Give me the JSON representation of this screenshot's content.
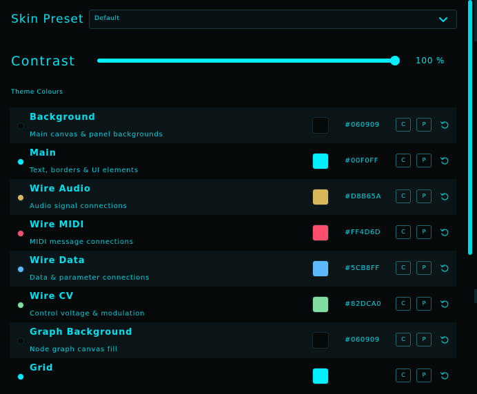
{
  "preset": {
    "label": "Skin Preset",
    "value": "Default"
  },
  "contrast": {
    "label": "Contrast",
    "value_text": "100 %",
    "value": 1.0
  },
  "theme": {
    "title": "Theme Colours",
    "rows": [
      {
        "name": "Background",
        "desc": "Main canvas & panel backgrounds",
        "hex": "#060909",
        "color": "#060909"
      },
      {
        "name": "Main",
        "desc": "Text, borders & UI elements",
        "hex": "#00F0FF",
        "color": "#00F0FF"
      },
      {
        "name": "Wire Audio",
        "desc": "Audio signal connections",
        "hex": "#D8B65A",
        "color": "#D8B65A"
      },
      {
        "name": "Wire MIDI",
        "desc": "MIDI message connections",
        "hex": "#FF4D6D",
        "color": "#FF4D6D"
      },
      {
        "name": "Wire Data",
        "desc": "Data & parameter connections",
        "hex": "#5CB8FF",
        "color": "#5CB8FF"
      },
      {
        "name": "Wire CV",
        "desc": "Control voltage & modulation",
        "hex": "#82DCA0",
        "color": "#82DCA0"
      },
      {
        "name": "Graph Background",
        "desc": "Node graph canvas fill",
        "hex": "#060909",
        "color": "#060909"
      },
      {
        "name": "Grid",
        "desc": "",
        "hex": "",
        "color": "#00F0FF"
      }
    ],
    "button_c": "C",
    "button_p": "P"
  },
  "icons": {
    "dropdown": "chevron-down-icon",
    "reset": "reset-icon"
  }
}
